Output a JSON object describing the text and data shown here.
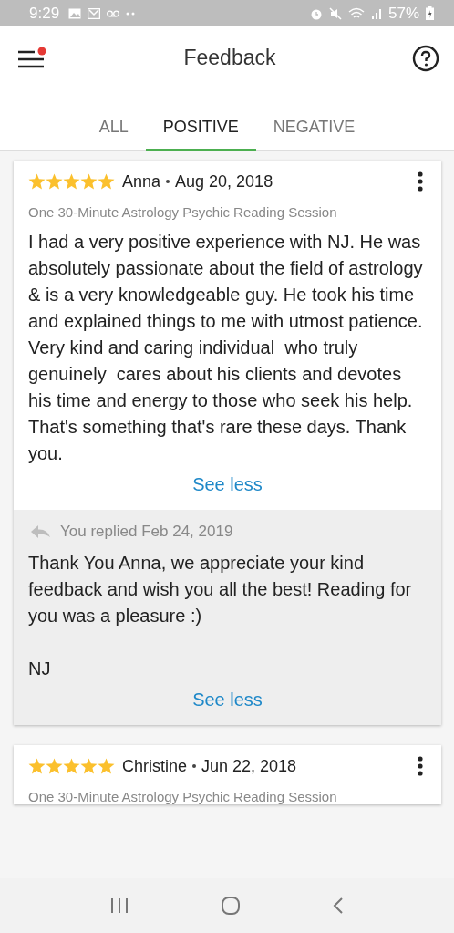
{
  "status_bar": {
    "time": "9:29",
    "battery": "57%"
  },
  "header": {
    "title": "Feedback",
    "notification": true
  },
  "tabs": [
    {
      "label": "ALL",
      "selected": false
    },
    {
      "label": "POSITIVE",
      "selected": true
    },
    {
      "label": "NEGATIVE",
      "selected": false
    }
  ],
  "reviews": [
    {
      "stars": 5,
      "name": "Anna",
      "date": "Aug 20, 2018",
      "service": "One 30-Minute Astrology Psychic Reading Session",
      "text": "I had a very positive experience with NJ. He was absolutely passionate about the field of astrology & is a very knowledgeable guy. He took his time and explained things to me with utmost patience. Very kind and caring individual  who truly genuinely  cares about his clients and devotes his time and energy to those who seek his help.  That's something that's rare these days. Thank you.",
      "toggle": "See less",
      "reply": {
        "label": "You replied Feb 24, 2019",
        "text": "Thank You Anna, we appreciate your kind feedback and wish you all the best! Reading for you was a pleasure :)",
        "signature": "NJ",
        "toggle": "See less"
      }
    },
    {
      "stars": 5,
      "name": "Christine",
      "date": "Jun 22, 2018",
      "service": "One 30-Minute Astrology Psychic Reading Session"
    }
  ]
}
